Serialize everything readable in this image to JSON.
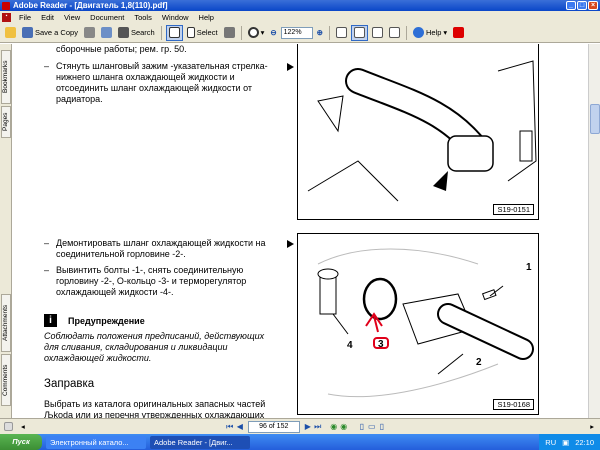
{
  "window": {
    "title": "Adobe Reader - [Двигатель 1,8(110).pdf]"
  },
  "menu": [
    "File",
    "Edit",
    "View",
    "Document",
    "Tools",
    "Window",
    "Help"
  ],
  "toolbar": {
    "save_copy": "Save a Copy",
    "search": "Search",
    "select": "Select",
    "zoom": "122%",
    "help": "Help"
  },
  "nav_tabs": {
    "bookmarks": "Bookmarks",
    "pages": "Pages",
    "attachments": "Attachments",
    "comments": "Comments"
  },
  "doc": {
    "line_top": "сборочные работы; рем. гр. 50.",
    "bullet1": [
      "Стянуть шланговый зажим -указательная стрелка-",
      "нижнего шланга охлаждающей жидкости и",
      "отсоединить шланг охлаждающей жидкости от",
      "радиатора."
    ],
    "fig1_label": "S19-0151",
    "bullet2": [
      "Демонтировать шланг охлаждающей жидкости на",
      "соединительной горловине -2-."
    ],
    "bullet3": [
      "Вывинтить болты -1-, снять соединительную",
      "горловину -2-, О-кольцо -3- и терморегулятор",
      "охлаждающей жидкости -4-."
    ],
    "warning_title": "Предупреждение",
    "warning_text": [
      "Соблюдать положения предписаний, действующих",
      "для сливания, складирования и ликвидации",
      "охлаждающей жидкости."
    ],
    "section_heading": "Заправка",
    "para": [
      "Выбрать из каталога оригинальных запасных частей",
      "Љkoda или из перечня утвержденных охлаждающих"
    ],
    "fig2_label": "S19-0168",
    "fig2_callouts": [
      "1",
      "2",
      "3",
      "4"
    ],
    "dash": "–"
  },
  "status": {
    "page": "96 of 152"
  },
  "taskbar": {
    "start": "Пуск",
    "task1": "Электронный катало...",
    "task2": "Adobe Reader - [Двиг...",
    "lang": "RU",
    "clock": "22:10"
  },
  "colors": {
    "titlebar": "#0a46c8",
    "chrome": "#ece9d8",
    "annotation_red": "#e0001a"
  }
}
